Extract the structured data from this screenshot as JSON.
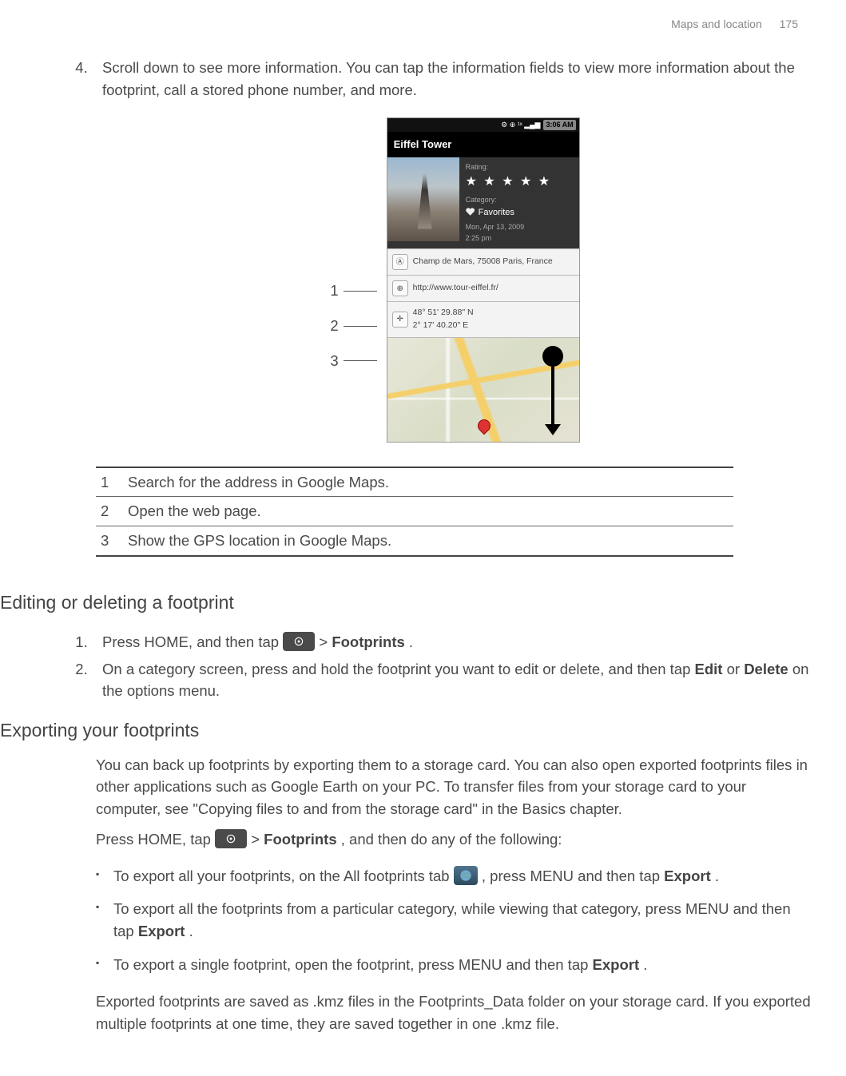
{
  "header": {
    "section": "Maps and location",
    "page": "175"
  },
  "step4": {
    "num": "4.",
    "text": "Scroll down to see more information. You can tap the information fields to view more information about the footprint, call a stored phone number, and more."
  },
  "phone": {
    "statusTime": "3:06 AM",
    "title": "Eiffel Tower",
    "ratingLabel": "Rating:",
    "categoryLabel": "Category:",
    "categoryValue": "Favorites",
    "dateLine1": "Mon, Apr 13, 2009",
    "dateLine2": "2:25 pm",
    "address": "Champ de Mars, 75008 Paris, France",
    "url": "http://www.tour-eiffel.fr/",
    "coords1": "48° 51' 29.88\" N",
    "coords2": "2° 17' 40.20\" E",
    "stars": "★ ★ ★ ★ ★"
  },
  "callouts": {
    "c1": "1",
    "c2": "2",
    "c3": "3"
  },
  "legend": [
    {
      "n": "1",
      "text": "Search for the address in Google Maps."
    },
    {
      "n": "2",
      "text": "Open the web page."
    },
    {
      "n": "3",
      "text": "Show the GPS location in Google Maps."
    }
  ],
  "editSection": {
    "heading": "Editing or deleting a footprint",
    "step1_num": "1.",
    "step1_a": "Press HOME, and then tap ",
    "step1_b": " > ",
    "step1_c": "Footprints",
    "step1_d": ".",
    "step2_num": "2.",
    "step2_a": "On a category screen, press and hold the footprint you want to edit or delete, and then tap ",
    "step2_b": "Edit",
    "step2_c": " or ",
    "step2_d": "Delete",
    "step2_e": " on the options menu."
  },
  "exportSection": {
    "heading": "Exporting your footprints",
    "intro": "You can back up footprints by exporting them to a storage card. You can also open exported footprints files in other applications such as Google Earth on your PC. To transfer files from your storage card to your computer, see \"Copying files to and from the storage card\" in the Basics chapter.",
    "lead_a": "Press HOME, tap ",
    "lead_b": " > ",
    "lead_c": "Footprints",
    "lead_d": ", and then do any of the following:",
    "b1_a": "To export all your footprints, on the All footprints tab ",
    "b1_b": " , press MENU and then tap ",
    "b1_c": "Export",
    "b1_d": ".",
    "b2_a": "To export all the footprints from a particular category, while viewing that category, press MENU and then tap ",
    "b2_b": "Export",
    "b2_c": ".",
    "b3_a": "To export a single footprint, open the footprint, press MENU and then tap ",
    "b3_b": "Export",
    "b3_c": ".",
    "outro": "Exported footprints are saved as .kmz files in the Footprints_Data folder on your storage card. If you exported multiple footprints at one time, they are saved together in one .kmz file."
  }
}
